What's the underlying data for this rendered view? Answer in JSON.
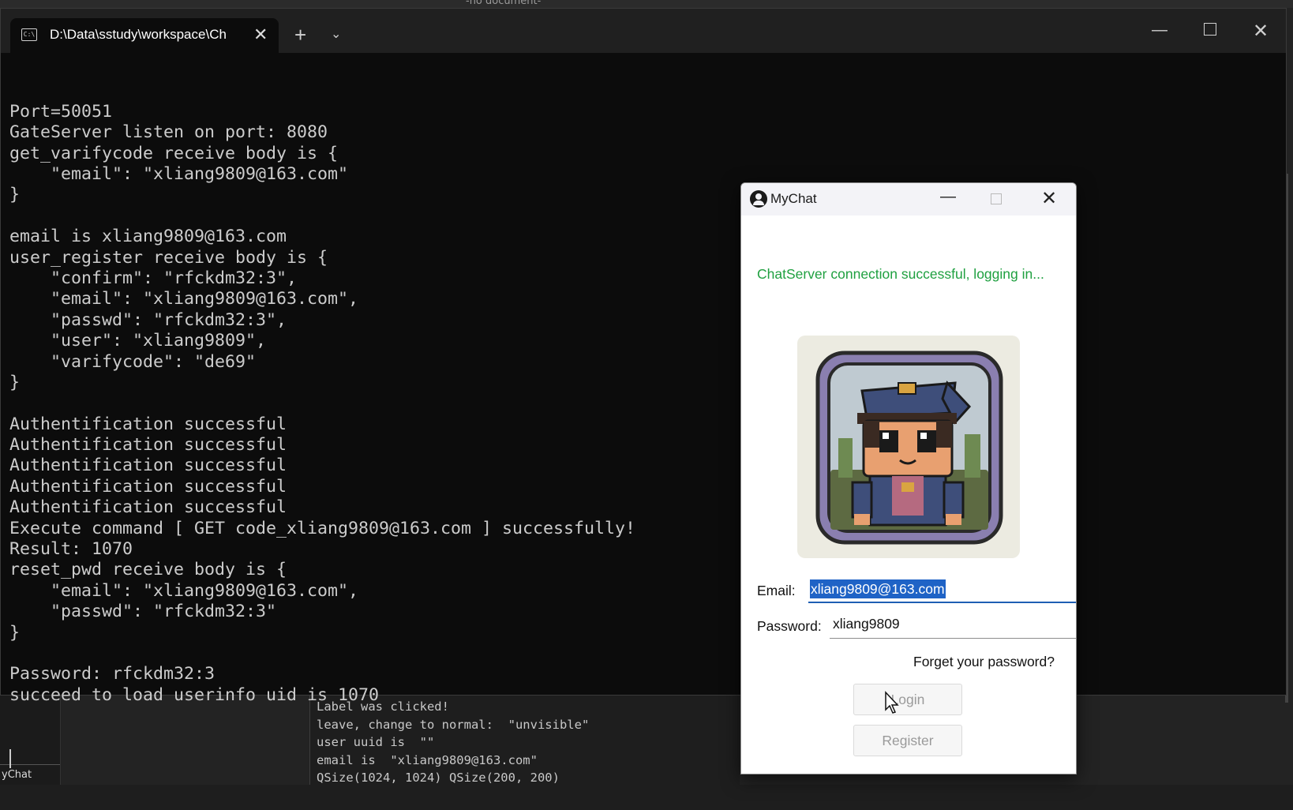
{
  "ide": {
    "document_label": "-no document-",
    "taskbar_label": "yChat",
    "output_lines": [
      "Label was clicked!",
      "leave, change to normal:  \"unvisible\"",
      "user uuid is  \"\"",
      "email is  \"xliang9809@163.com\"",
      "QSize(1024, 1024) QSize(200, 200)"
    ]
  },
  "terminal": {
    "tab_title": "D:\\Data\\sstudy\\workspace\\Ch",
    "tab_icon": "terminal-icon",
    "lines": [
      "Port=50051",
      "GateServer listen on port: 8080",
      "get_varifycode receive body is {",
      "    \"email\": \"xliang9809@163.com\"",
      "}",
      "",
      "email is xliang9809@163.com",
      "user_register receive body is {",
      "    \"confirm\": \"rfckdm32:3\",",
      "    \"email\": \"xliang9809@163.com\",",
      "    \"passwd\": \"rfckdm32:3\",",
      "    \"user\": \"xliang9809\",",
      "    \"varifycode\": \"de69\"",
      "}",
      "",
      "Authentification successful",
      "Authentification successful",
      "Authentification successful",
      "Authentification successful",
      "Authentification successful",
      "Execute command [ GET code_xliang9809@163.com ] successfully!",
      "Result: 1070",
      "reset_pwd receive body is {",
      "    \"email\": \"xliang9809@163.com\",",
      "    \"passwd\": \"rfckdm32:3\"",
      "}",
      "",
      "Password: rfckdm32:3",
      "succeed to load userinfo uid is 1070"
    ]
  },
  "dialog": {
    "title": "MyChat",
    "status": "ChatServer connection successful, logging in...",
    "status_color": "#1fa040",
    "email_label": "Email:",
    "email_value": "xliang9809@163.com",
    "password_label": "Password:",
    "password_value": "xliang9809",
    "forget_link": "Forget your password?",
    "login_button": "Login",
    "register_button": "Register"
  },
  "colors": {
    "terminal_bg": "#0c0c0c",
    "terminal_text": "#cccccc",
    "selection": "#1f63c6"
  }
}
